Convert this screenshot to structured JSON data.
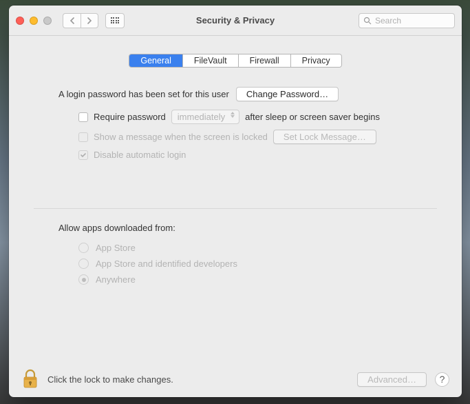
{
  "window": {
    "title": "Security & Privacy"
  },
  "search": {
    "placeholder": "Search"
  },
  "tabs": [
    {
      "label": "General",
      "active": true
    },
    {
      "label": "FileVault",
      "active": false
    },
    {
      "label": "Firewall",
      "active": false
    },
    {
      "label": "Privacy",
      "active": false
    }
  ],
  "login": {
    "message": "A login password has been set for this user",
    "change_button": "Change Password…"
  },
  "options": {
    "require_password": {
      "label_before": "Require password",
      "select_value": "immediately",
      "label_after": "after sleep or screen saver begins"
    },
    "show_message": {
      "label": "Show a message when the screen is locked",
      "button": "Set Lock Message…"
    },
    "disable_auto": {
      "label": "Disable automatic login"
    }
  },
  "allow": {
    "title": "Allow apps downloaded from:",
    "items": [
      "App Store",
      "App Store and identified developers",
      "Anywhere"
    ]
  },
  "footer": {
    "lock_text": "Click the lock to make changes.",
    "advanced": "Advanced…",
    "help": "?"
  }
}
